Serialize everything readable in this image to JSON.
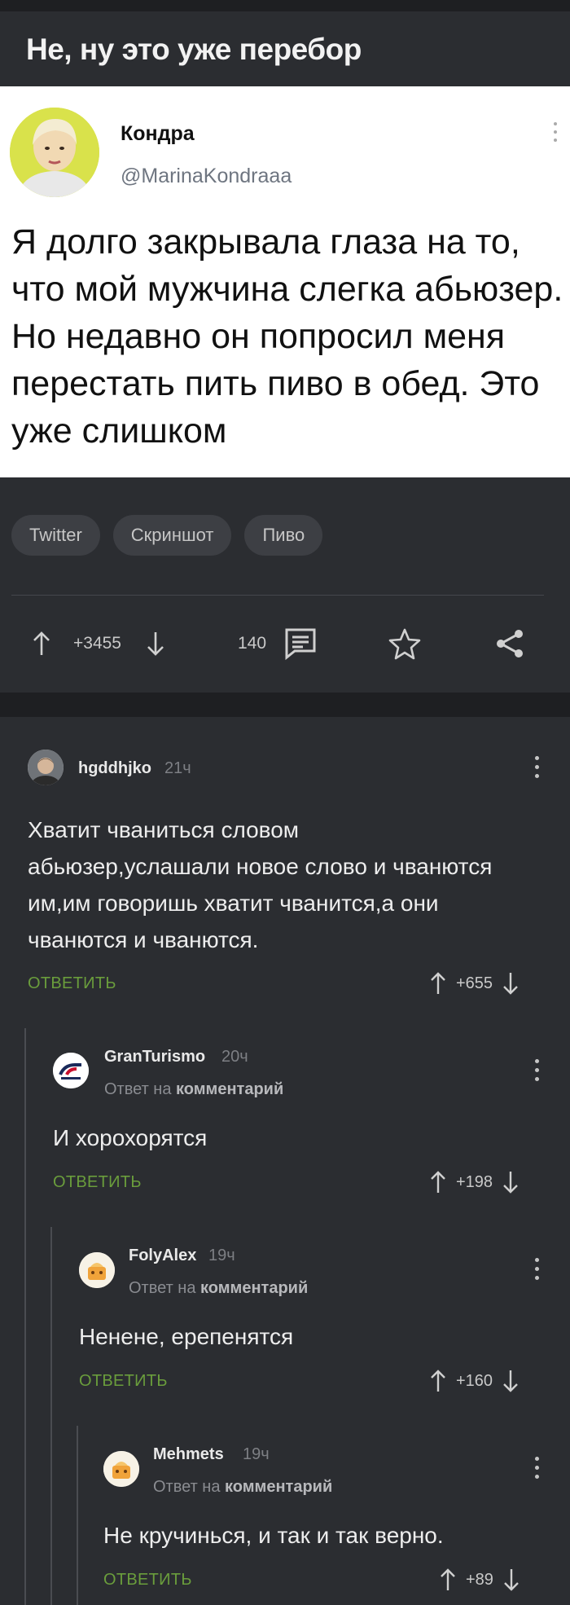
{
  "post": {
    "title": "Не, ну это уже перебор",
    "tweet": {
      "name": "Кондра",
      "handle": "@MarinaKondraaa",
      "text": "Я долго закрывала глаза на то, что мой мужчина слегка абьюзер. Но недавно он попросил меня перестать пить пиво в обед. Это уже слишком"
    },
    "tags": [
      "Twitter",
      "Скриншот",
      "Пиво"
    ],
    "rating": "+3455",
    "comments_count": "140"
  },
  "comments": [
    {
      "author": "hgddhjko",
      "time": "21ч",
      "text": "Хватит чваниться словом абьюзер,услашали новое слово и чванются им,им говоришь хватит чванится,а они чванются и чванются.",
      "answer_label": "ОТВЕТИТЬ",
      "rating": "+655"
    },
    {
      "author": "GranTurismo",
      "time": "20ч",
      "reply_prefix": "Ответ на",
      "reply_target": "комментарий",
      "text": "И хорохорятся",
      "answer_label": "ОТВЕТИТЬ",
      "rating": "+198"
    },
    {
      "author": "FolyAlex",
      "time": "19ч",
      "reply_prefix": "Ответ на",
      "reply_target": "комментарий",
      "text": "Ненене, ерепенятся",
      "answer_label": "ОТВЕТИТЬ",
      "rating": "+160"
    },
    {
      "author": "Mehmets",
      "time": "19ч",
      "reply_prefix": "Ответ на",
      "reply_target": "комментарий",
      "text": "Не кручинься, и так и так верно.",
      "answer_label": "ОТВЕТИТЬ",
      "rating": "+89"
    }
  ],
  "icons": {
    "upvote": "arrow-up-icon",
    "downvote": "arrow-down-icon",
    "comments": "comment-icon",
    "save": "star-icon",
    "share": "share-icon",
    "more": "kebab-menu-icon"
  },
  "colors": {
    "background": "#2b2d31",
    "accent_green": "#6a9d3c",
    "tag_bg": "#3d3f44"
  }
}
